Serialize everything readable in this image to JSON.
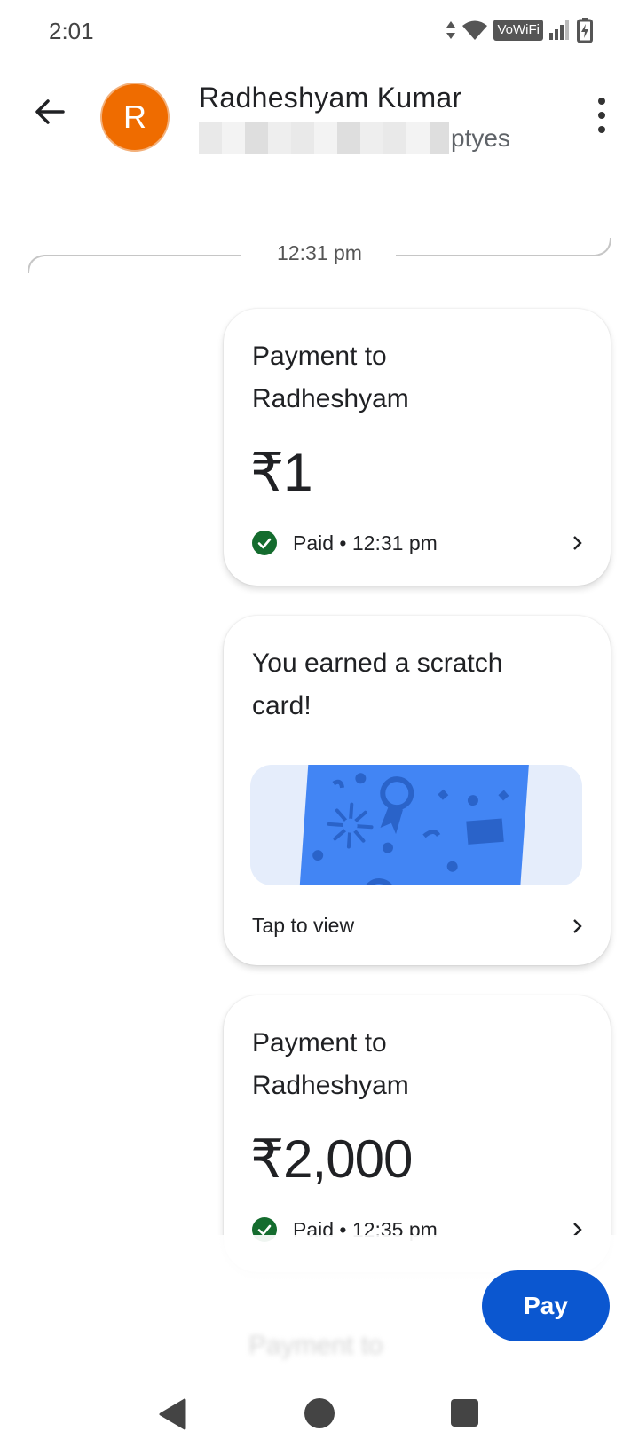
{
  "status_bar": {
    "time": "2:01",
    "vowifi_label": "VoWiFi"
  },
  "header": {
    "contact_initial": "R",
    "contact_name": "Radheshyam Kumar",
    "contact_sub_visible": "ptyes",
    "avatar_color": "#ef6c00"
  },
  "timeline": {
    "divider_time": "12:31 pm"
  },
  "cards": [
    {
      "title_line1": "Payment to",
      "title_line2": "Radheshyam",
      "amount": "₹1",
      "status": "Paid • 12:31 pm"
    },
    {
      "title_line1": "You earned a scratch",
      "title_line2": "card!",
      "action": "Tap to view"
    },
    {
      "title_line1": "Payment to",
      "title_line2": "Radheshyam",
      "amount": "₹2,000",
      "status": "Paid • 12:35 pm"
    }
  ],
  "ghost_text": "Payment to",
  "pay_button": "Pay",
  "colors": {
    "accent": "#0b57d0",
    "paid_check": "#146c2e",
    "scratch_card": "#4285f4",
    "scratch_bg": "#e5edfb"
  }
}
